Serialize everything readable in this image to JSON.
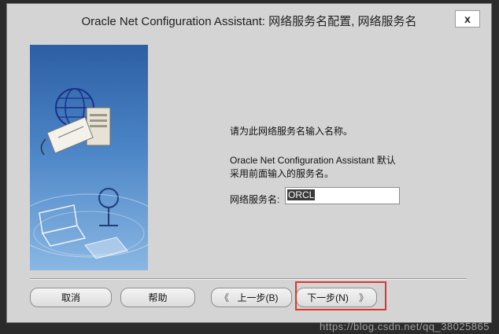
{
  "window": {
    "title": "Oracle Net Configuration Assistant: 网络服务名配置, 网络服务名",
    "close_label": "x"
  },
  "content": {
    "prompt": "请为此网络服务名输入名称。",
    "info_line1": "Oracle Net Configuration Assistant 默认",
    "info_line2": "采用前面输入的服务名。"
  },
  "field": {
    "label": "网络服务名:",
    "value": "ORCL"
  },
  "buttons": {
    "cancel": "取消",
    "help": "帮助",
    "back": "上一步(B)",
    "next": "下一步(N)"
  },
  "icons": {
    "back_arrow": "《",
    "next_arrow": "》"
  },
  "watermark": "https://blog.csdn.net/qq_38025865"
}
